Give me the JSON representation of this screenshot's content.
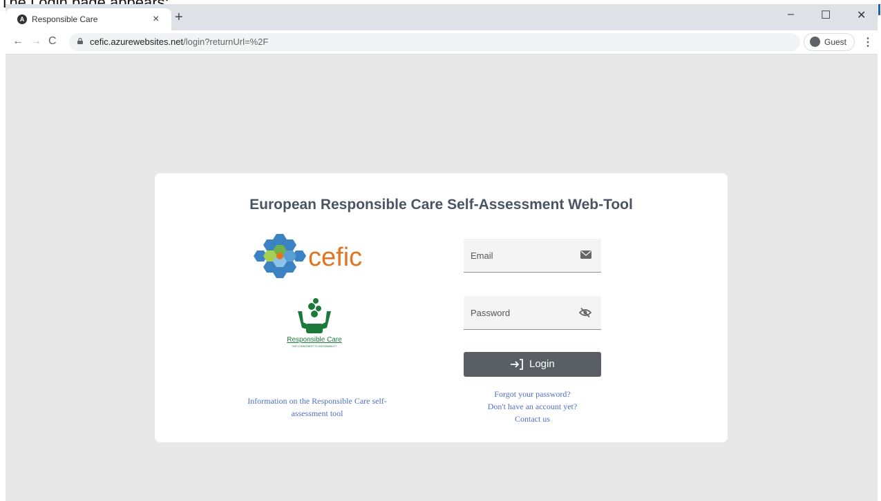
{
  "caption": "The Login page appears:",
  "browser": {
    "tab_title": "Responsible Care",
    "tab_close": "×",
    "new_tab": "+",
    "url_host": "cefic.azurewebsites.net",
    "url_path": "/login?returnUrl=%2F",
    "profile_label": "Guest",
    "window_controls": [
      "–",
      "☐",
      "✕"
    ]
  },
  "login": {
    "title": "European Responsible Care Self-Assessment Web-Tool",
    "cefic_logo_text": "cefic",
    "rc_logo_text": "Responsible Care",
    "rc_tagline": "OUR COMMITMENT TO SUSTAINABILITY",
    "info_link": "Information on the Responsible Care self-assessment tool",
    "email_placeholder": "Email",
    "password_placeholder": "Password",
    "login_button": "Login",
    "forgot_password": "Forgot your password?",
    "no_account": "Don't have an account yet?",
    "contact_us": "Contact us"
  },
  "colors": {
    "page_background": "#e8e8e8",
    "title_color": "#4a5462",
    "link_color": "#4f6fc9",
    "button_color": "#5a5f66",
    "cefic_orange": "#e2741f",
    "rc_green": "#1b7a3a"
  },
  "icons": {
    "email": "envelope-icon",
    "password": "eye-off-icon",
    "login": "login-arrow-icon"
  }
}
